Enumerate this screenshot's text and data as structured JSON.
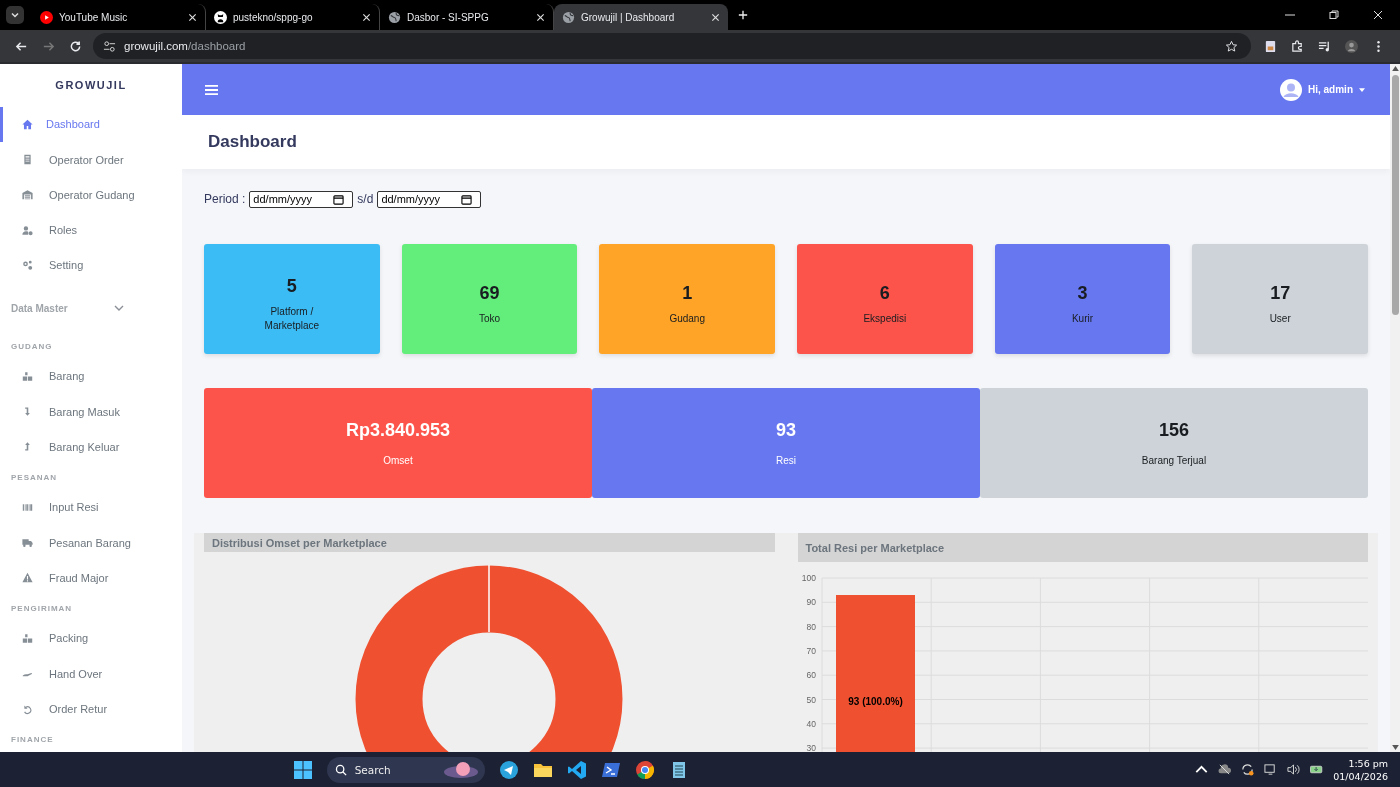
{
  "browser": {
    "tabs": [
      {
        "title": "YouTube Music",
        "selected": false
      },
      {
        "title": "pustekno/sppg-go",
        "selected": false
      },
      {
        "title": "Dasbor - SI-SPPG",
        "selected": false
      },
      {
        "title": "Growujil | Dashboard",
        "selected": true
      }
    ],
    "url_host": "growujil.com",
    "url_path": "/dashboard"
  },
  "sidebar": {
    "brand": "GROWUJIL",
    "items": [
      {
        "kind": "item",
        "label": "Dashboard",
        "selected": true
      },
      {
        "kind": "item",
        "label": "Operator Order",
        "selected": false
      },
      {
        "kind": "item",
        "label": "Operator Gudang",
        "selected": false
      },
      {
        "kind": "item",
        "label": "Roles",
        "selected": false
      },
      {
        "kind": "item",
        "label": "Setting",
        "selected": false
      },
      {
        "kind": "group",
        "label": "Data Master"
      },
      {
        "kind": "heading",
        "label": "GUDANG"
      },
      {
        "kind": "item",
        "label": "Barang",
        "selected": false
      },
      {
        "kind": "item",
        "label": "Barang Masuk",
        "selected": false
      },
      {
        "kind": "item",
        "label": "Barang Keluar",
        "selected": false
      },
      {
        "kind": "heading",
        "label": "PESANAN"
      },
      {
        "kind": "item",
        "label": "Input Resi",
        "selected": false
      },
      {
        "kind": "item",
        "label": "Pesanan Barang",
        "selected": false
      },
      {
        "kind": "item",
        "label": "Fraud Major",
        "selected": false
      },
      {
        "kind": "heading",
        "label": "PENGIRIMAN"
      },
      {
        "kind": "item",
        "label": "Packing",
        "selected": false
      },
      {
        "kind": "item",
        "label": "Hand Over",
        "selected": false
      },
      {
        "kind": "item",
        "label": "Order Retur",
        "selected": false
      },
      {
        "kind": "heading",
        "label": "FINANCE"
      }
    ]
  },
  "topbar": {
    "user": "Hi, admin"
  },
  "page_title": "Dashboard",
  "period": {
    "label": "Period :",
    "from_placeholder": "dd/mm/yyyy",
    "separator": "s/d",
    "to_placeholder": "dd/mm/yyyy"
  },
  "stat_cards": [
    {
      "value": "5",
      "label": "Platform / Marketplace",
      "color": "#3bbcf5"
    },
    {
      "value": "69",
      "label": "Toko",
      "color": "#63ed7a"
    },
    {
      "value": "1",
      "label": "Gudang",
      "color": "#ffa426"
    },
    {
      "value": "6",
      "label": "Ekspedisi",
      "color": "#fc544b"
    },
    {
      "value": "3",
      "label": "Kurir",
      "color": "#6777ef"
    },
    {
      "value": "17",
      "label": "User",
      "color": "#cdd3d8"
    }
  ],
  "summary_cards": [
    {
      "value": "Rp3.840.953",
      "label": "Omset",
      "color": "#fc544b"
    },
    {
      "value": "93",
      "label": "Resi",
      "color": "#6777ef"
    },
    {
      "value": "156",
      "label": "Barang Terjual",
      "color": "#cdd3d8"
    }
  ],
  "donut_panel": {
    "title": "Distribusi Omset per Marketplace"
  },
  "bar_panel": {
    "title": "Total Resi per Marketplace",
    "chart_data": {
      "type": "bar",
      "ylim": [
        0,
        100
      ],
      "yticks": [
        30,
        40,
        50,
        60,
        70,
        80,
        90,
        100
      ],
      "grid": true,
      "series": [
        {
          "color": "#ef5130",
          "values": [
            93
          ]
        }
      ],
      "value_labels": [
        "93 (100.0%)"
      ]
    }
  },
  "taskbar": {
    "search": "Search",
    "time": "1:56 pm",
    "date": "01/04/2026"
  }
}
